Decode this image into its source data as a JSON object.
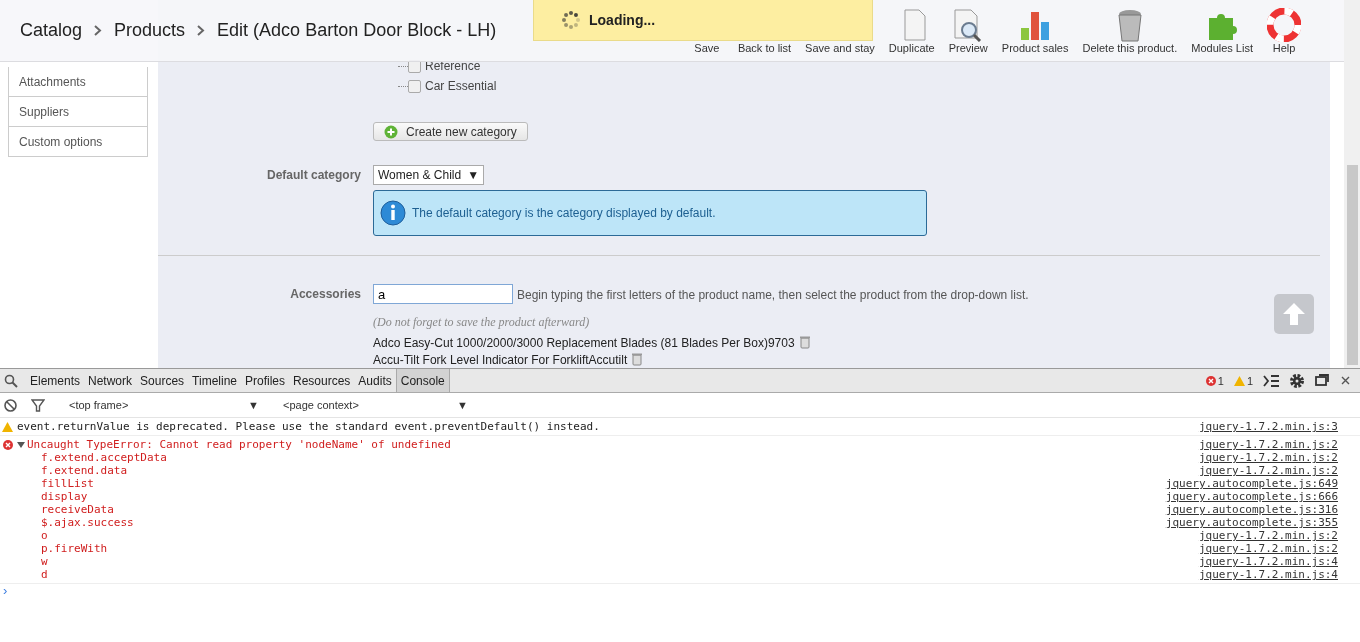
{
  "breadcrumb": [
    "Catalog",
    "Products",
    "Edit (Adco Barton Door Block - LH)"
  ],
  "loading": "Loading...",
  "toolbar": [
    "Save",
    "Back to list",
    "Save and stay",
    "Duplicate",
    "Preview",
    "Product sales",
    "Delete this product.",
    "Modules List",
    "Help"
  ],
  "sidebar": {
    "items": [
      {
        "label": "Attachments"
      },
      {
        "label": "Suppliers"
      },
      {
        "label": "Custom options"
      }
    ]
  },
  "categories": [
    {
      "label": "Reference",
      "checked": false
    },
    {
      "label": "Car Essential",
      "checked": false
    }
  ],
  "create_category_button": "Create new category",
  "default_category": {
    "label": "Default category",
    "value": "Women & Child",
    "caret": "▼",
    "info": "The default category is the category displayed by default."
  },
  "accessories": {
    "label": "Accessories",
    "value": "a",
    "hint": "Begin typing the first letters of the product name, then select the product from the drop-down list.",
    "note": "(Do not forget to save the product afterward)",
    "items": [
      "Adco Easy-Cut 1000/2000/3000 Replacement Blades (81 Blades Per Box)9703",
      "Accu-Tilt Fork Level Indicator For ForkliftAccutilt"
    ]
  },
  "devtools": {
    "tabs": [
      {
        "label": "Elements",
        "selected": false
      },
      {
        "label": "Network",
        "selected": false
      },
      {
        "label": "Sources",
        "selected": false
      },
      {
        "label": "Timeline",
        "selected": false
      },
      {
        "label": "Profiles",
        "selected": false
      },
      {
        "label": "Resources",
        "selected": false
      },
      {
        "label": "Audits",
        "selected": false
      },
      {
        "label": "Console",
        "selected": true
      }
    ],
    "error_count": "1",
    "warning_count": "1",
    "frame_select": {
      "value": "<top frame>",
      "caret": "▼"
    },
    "context_select": {
      "value": "<page context>",
      "caret": "▼"
    },
    "messages": [
      {
        "kind": "warning",
        "text": "event.returnValue is deprecated. Please use the standard event.preventDefault() instead.",
        "source": "jquery-1.7.2.min.js:3"
      },
      {
        "kind": "error",
        "text": "Uncaught TypeError: Cannot read property 'nodeName' of undefined",
        "source": "jquery-1.7.2.min.js:2",
        "expanded": true,
        "stack": [
          {
            "fn": "f.extend.acceptData",
            "source": "jquery-1.7.2.min.js:2"
          },
          {
            "fn": "f.extend.data",
            "source": "jquery-1.7.2.min.js:2"
          },
          {
            "fn": "fillList",
            "source": "jquery.autocomplete.js:649"
          },
          {
            "fn": "display",
            "source": "jquery.autocomplete.js:666"
          },
          {
            "fn": "receiveData",
            "source": "jquery.autocomplete.js:316"
          },
          {
            "fn": "$.ajax.success",
            "source": "jquery.autocomplete.js:355"
          },
          {
            "fn": "o",
            "source": "jquery-1.7.2.min.js:2"
          },
          {
            "fn": "p.fireWith",
            "source": "jquery-1.7.2.min.js:2"
          },
          {
            "fn": "w",
            "source": "jquery-1.7.2.min.js:4"
          },
          {
            "fn": "d",
            "source": "jquery-1.7.2.min.js:4"
          }
        ]
      }
    ],
    "prompt": "›"
  }
}
